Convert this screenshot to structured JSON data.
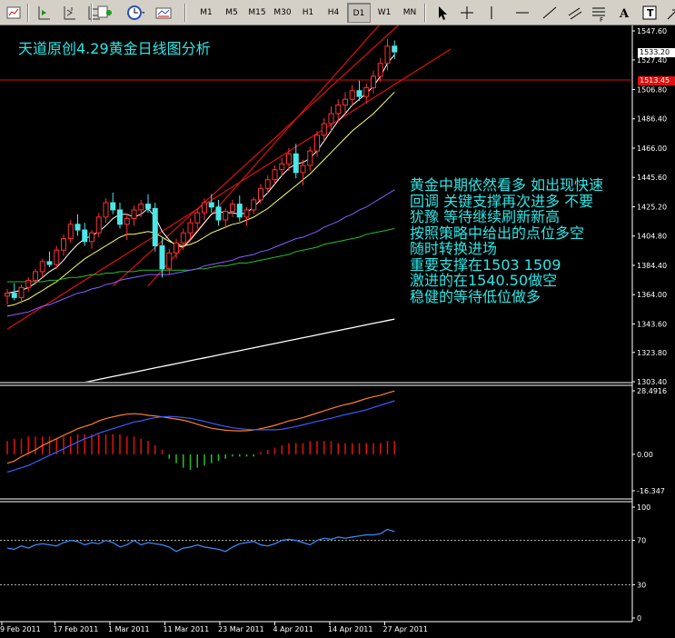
{
  "toolbar": {
    "timeframes": [
      "M1",
      "M5",
      "M15",
      "M30",
      "H1",
      "H4",
      "D1",
      "W1",
      "MN"
    ],
    "active_timeframe": "D1",
    "icons": [
      "indicator-list-icon",
      "navigator-icon",
      "zoom-icon",
      "new-order-icon",
      "clock-icon",
      "template-icon",
      "cursor-icon",
      "crosshair-icon",
      "vertical-line-icon",
      "horizontal-line-icon",
      "trendline-icon",
      "channel-icon",
      "fibonacci-icon",
      "text-icon",
      "label-icon",
      "arrow-icon"
    ]
  },
  "annotations": {
    "title": "天道原创4.29黄金日线图分析",
    "analysis_lines": [
      "黄金中期依然看多 如出现快速",
      "回调 关键支撑再次进多 不要",
      "犹豫  等待继续刷新新高",
      "按照策略中给出的点位多空",
      "随时转换进场",
      "重要支撑在1503    1509",
      "激进的在1540.50做空",
      "稳健的等待低位做多"
    ]
  },
  "price_tags": {
    "current_price": "1533.20",
    "horizontal_line": "1513.45"
  },
  "colors": {
    "bull_candle": "#ff3333",
    "bear_candle": "#4de6e6",
    "annotation": "#2ee6e6",
    "trendline": "#e01010",
    "ma_white": "#ffffff",
    "ma_yellow": "#ffff66",
    "ma_purple": "#8a5cff",
    "ma_green": "#22c02a",
    "macd_orange": "#ff7f27",
    "macd_blue": "#3b5bff",
    "stoch_line": "#3b8eff",
    "hist_positive": "#e01010",
    "hist_negative": "#22c02a"
  },
  "chart_data": [
    {
      "type": "line",
      "title": "",
      "symbol_timeframe": "D1",
      "y_ticks": [
        "1547.60",
        "1527.40",
        "1506.80",
        "1486.40",
        "1466.00",
        "1445.60",
        "1425.20",
        "1404.80",
        "1384.40",
        "1364.00",
        "1343.60",
        "1323.80",
        "1303.40"
      ],
      "ylim": [
        1303.4,
        1547.6
      ],
      "x_ticks": [
        "9 Feb 2011",
        "17 Feb 2011",
        "1 Mar 2011",
        "11 Mar 2011",
        "23 Mar 2011",
        "4 Apr 2011",
        "14 Apr 2011",
        "27 Apr 2011"
      ],
      "candles": [
        [
          1363,
          1368,
          1357,
          1365
        ],
        [
          1365,
          1372,
          1360,
          1362
        ],
        [
          1362,
          1371,
          1358,
          1369
        ],
        [
          1369,
          1376,
          1366,
          1374
        ],
        [
          1374,
          1382,
          1371,
          1380
        ],
        [
          1380,
          1389,
          1376,
          1387
        ],
        [
          1387,
          1394,
          1383,
          1385
        ],
        [
          1385,
          1398,
          1382,
          1395
        ],
        [
          1395,
          1406,
          1391,
          1403
        ],
        [
          1403,
          1416,
          1400,
          1413
        ],
        [
          1413,
          1420,
          1405,
          1409
        ],
        [
          1409,
          1414,
          1398,
          1401
        ],
        [
          1401,
          1409,
          1396,
          1407
        ],
        [
          1407,
          1421,
          1404,
          1418
        ],
        [
          1418,
          1431,
          1414,
          1428
        ],
        [
          1428,
          1435,
          1420,
          1423
        ],
        [
          1423,
          1428,
          1410,
          1413
        ],
        [
          1413,
          1420,
          1402,
          1417
        ],
        [
          1417,
          1426,
          1412,
          1423
        ],
        [
          1423,
          1430,
          1418,
          1427
        ],
        [
          1427,
          1434,
          1421,
          1424
        ],
        [
          1424,
          1428,
          1394,
          1398
        ],
        [
          1398,
          1404,
          1376,
          1382
        ],
        [
          1382,
          1396,
          1378,
          1393
        ],
        [
          1393,
          1403,
          1389,
          1400
        ],
        [
          1400,
          1410,
          1395,
          1407
        ],
        [
          1407,
          1417,
          1403,
          1414
        ],
        [
          1414,
          1424,
          1410,
          1421
        ],
        [
          1421,
          1431,
          1416,
          1428
        ],
        [
          1428,
          1434,
          1421,
          1425
        ],
        [
          1425,
          1430,
          1412,
          1416
        ],
        [
          1416,
          1424,
          1410,
          1422
        ],
        [
          1422,
          1430,
          1418,
          1427
        ],
        [
          1427,
          1433,
          1415,
          1418
        ],
        [
          1418,
          1425,
          1412,
          1423
        ],
        [
          1423,
          1432,
          1420,
          1430
        ],
        [
          1430,
          1441,
          1427,
          1438
        ],
        [
          1438,
          1447,
          1434,
          1444
        ],
        [
          1444,
          1454,
          1441,
          1451
        ],
        [
          1451,
          1459,
          1446,
          1455
        ],
        [
          1455,
          1466,
          1450,
          1462
        ],
        [
          1462,
          1469,
          1445,
          1449
        ],
        [
          1449,
          1458,
          1440,
          1454
        ],
        [
          1454,
          1467,
          1450,
          1464
        ],
        [
          1464,
          1478,
          1460,
          1475
        ],
        [
          1475,
          1487,
          1471,
          1483
        ],
        [
          1483,
          1495,
          1478,
          1490
        ],
        [
          1490,
          1500,
          1484,
          1496
        ],
        [
          1496,
          1505,
          1490,
          1500
        ],
        [
          1500,
          1510,
          1495,
          1506
        ],
        [
          1506,
          1513,
          1499,
          1502
        ],
        [
          1502,
          1511,
          1497,
          1508
        ],
        [
          1508,
          1520,
          1504,
          1516
        ],
        [
          1516,
          1529,
          1512,
          1525
        ],
        [
          1525,
          1542,
          1520,
          1537
        ],
        [
          1537,
          1541,
          1528,
          1533
        ]
      ],
      "trendlines": [
        {
          "start": [
            0,
            1340.0
          ],
          "end": [
            63,
            1535.0
          ]
        },
        {
          "start": [
            15,
            1370.0
          ],
          "end": [
            63,
            1585.0
          ]
        },
        {
          "start": [
            20,
            1370.0
          ],
          "end": [
            63,
            1608.0
          ]
        }
      ],
      "horizontal_line": 1513.45,
      "moving_averages": [
        {
          "name": "white",
          "values": [
            1365,
            1366,
            1367,
            1369,
            1372,
            1376,
            1380,
            1383,
            1388,
            1394,
            1399,
            1403,
            1405,
            1408,
            1412,
            1417,
            1420,
            1420,
            1418,
            1420,
            1424,
            1418,
            1408,
            1402,
            1398,
            1397,
            1402,
            1408,
            1414,
            1420,
            1422,
            1421,
            1421,
            1420,
            1421,
            1425,
            1430,
            1435,
            1441,
            1447,
            1452,
            1455,
            1456,
            1459,
            1464,
            1471,
            1478,
            1485,
            1490,
            1496,
            1500,
            1504,
            1509,
            1516,
            1525,
            1531
          ]
        },
        {
          "name": "yellow",
          "values": [
            1356,
            1357,
            1359,
            1361,
            1364,
            1367,
            1370,
            1373,
            1377,
            1381,
            1385,
            1389,
            1392,
            1395,
            1398,
            1401,
            1404,
            1406,
            1406,
            1407,
            1408,
            1407,
            1404,
            1401,
            1399,
            1398,
            1399,
            1401,
            1404,
            1407,
            1409,
            1411,
            1413,
            1414,
            1416,
            1418,
            1421,
            1424,
            1428,
            1432,
            1436,
            1440,
            1444,
            1448,
            1453,
            1458,
            1463,
            1468,
            1473,
            1478,
            1482,
            1486,
            1490,
            1495,
            1500,
            1505
          ]
        },
        {
          "name": "green",
          "values": [
            1373,
            1373,
            1373,
            1373,
            1373,
            1373,
            1374,
            1374,
            1375,
            1376,
            1376,
            1377,
            1378,
            1378,
            1379,
            1379,
            1380,
            1380,
            1380,
            1381,
            1381,
            1381,
            1381,
            1381,
            1381,
            1381,
            1381,
            1382,
            1382,
            1383,
            1384,
            1384,
            1385,
            1386,
            1386,
            1387,
            1388,
            1389,
            1390,
            1391,
            1392,
            1394,
            1395,
            1396,
            1397,
            1399,
            1400,
            1401,
            1402,
            1403,
            1404,
            1406,
            1407,
            1408,
            1409,
            1410
          ]
        },
        {
          "name": "purple",
          "values": [
            1349,
            1350,
            1351,
            1352,
            1354,
            1356,
            1357,
            1359,
            1361,
            1363,
            1365,
            1366,
            1368,
            1369,
            1371,
            1372,
            1374,
            1375,
            1376,
            1377,
            1378,
            1378,
            1378,
            1378,
            1379,
            1380,
            1381,
            1382,
            1384,
            1385,
            1386,
            1387,
            1388,
            1390,
            1391,
            1392,
            1394,
            1395,
            1397,
            1399,
            1401,
            1403,
            1404,
            1406,
            1408,
            1411,
            1413,
            1415,
            1418,
            1420,
            1423,
            1425,
            1428,
            1431,
            1434,
            1437
          ]
        },
        {
          "name": "white-long",
          "values": [
            1292,
            1293,
            1294,
            1295,
            1296,
            1297,
            1298,
            1299,
            1300,
            1301,
            1302,
            1303,
            1304,
            1305,
            1306,
            1307,
            1308,
            1309,
            1310,
            1311,
            1312,
            1313,
            1314,
            1315,
            1316,
            1317,
            1318,
            1319,
            1320,
            1321,
            1322,
            1323,
            1324,
            1325,
            1326,
            1327,
            1328,
            1329,
            1330,
            1331,
            1332,
            1333,
            1334,
            1335,
            1336,
            1337,
            1338,
            1339,
            1340,
            1341,
            1342,
            1343,
            1344,
            1345,
            1346,
            1347
          ]
        }
      ]
    },
    {
      "type": "line",
      "title": "",
      "y_ticks": [
        "28.4916",
        "0.00",
        "-16.347"
      ],
      "ylim": [
        -16.347,
        28.4916
      ],
      "series": [
        {
          "name": "",
          "values": [
            -4,
            -3,
            -1,
            0.5,
            2,
            4,
            5.5,
            7,
            8.5,
            10,
            11.5,
            12.5,
            13.5,
            15,
            16,
            16.8,
            17.5,
            18,
            18.2,
            18.0,
            17.5,
            17.2,
            16.8,
            16.3,
            15.8,
            15.3,
            14.5,
            13.5,
            12.5,
            11.7,
            11.2,
            10.8,
            10.6,
            10.5,
            10.6,
            10.9,
            11.5,
            12.2,
            13.0,
            14.0,
            15.0,
            15.7,
            16.5,
            17.5,
            18.5,
            19.5,
            20.5,
            21.5,
            22.3,
            23.0,
            24.0,
            25.0,
            25.8,
            26.5,
            27.5,
            28.4
          ]
        },
        {
          "name": "",
          "values": [
            -8,
            -7,
            -6,
            -5,
            -3.5,
            -2,
            -0.5,
            1,
            2.5,
            4,
            5.5,
            7,
            8,
            9.5,
            10.5,
            11.5,
            12.5,
            13.5,
            14.5,
            15,
            15.8,
            16.5,
            16.8,
            17,
            16.8,
            16.5,
            16.2,
            15.5,
            14.8,
            14.0,
            13.2,
            12.5,
            11.9,
            11.5,
            11.2,
            11.0,
            11.0,
            11.0,
            11.0,
            11.2,
            11.8,
            12.5,
            13.2,
            14.0,
            14.8,
            15.5,
            16.2,
            17.0,
            17.8,
            18.5,
            19.2,
            20,
            21,
            22,
            23,
            24
          ]
        }
      ],
      "histogram": [
        6,
        7,
        7,
        8,
        8,
        8,
        8,
        7,
        8,
        8,
        9,
        9,
        9,
        9,
        9,
        9,
        9,
        8,
        8,
        7,
        6,
        4,
        2,
        -2,
        -4,
        -6,
        -7,
        -6,
        -5,
        -4,
        -3,
        -2,
        -1,
        -1,
        -1,
        -1,
        1,
        2,
        3,
        4,
        5,
        5,
        5,
        6,
        6,
        6,
        6,
        5,
        5,
        5,
        5,
        5,
        5,
        5,
        6,
        6
      ]
    },
    {
      "type": "line",
      "title": "",
      "y_ticks": [
        "100",
        "70",
        "30",
        "0"
      ],
      "ylim": [
        0,
        100
      ],
      "reference_levels": [
        70,
        30
      ],
      "series": [
        {
          "name": "",
          "values": [
            63,
            62,
            65,
            63,
            66,
            67,
            66,
            65,
            68,
            70,
            69,
            66,
            68,
            67,
            70,
            68,
            64,
            66,
            70,
            66,
            68,
            67,
            66,
            64,
            60,
            63,
            64,
            66,
            64,
            63,
            62,
            60,
            64,
            67,
            68,
            69,
            66,
            65,
            67,
            70,
            71,
            70,
            68,
            66,
            70,
            72,
            71,
            73,
            72,
            73,
            74,
            75,
            75,
            76,
            80,
            78
          ]
        }
      ]
    }
  ]
}
